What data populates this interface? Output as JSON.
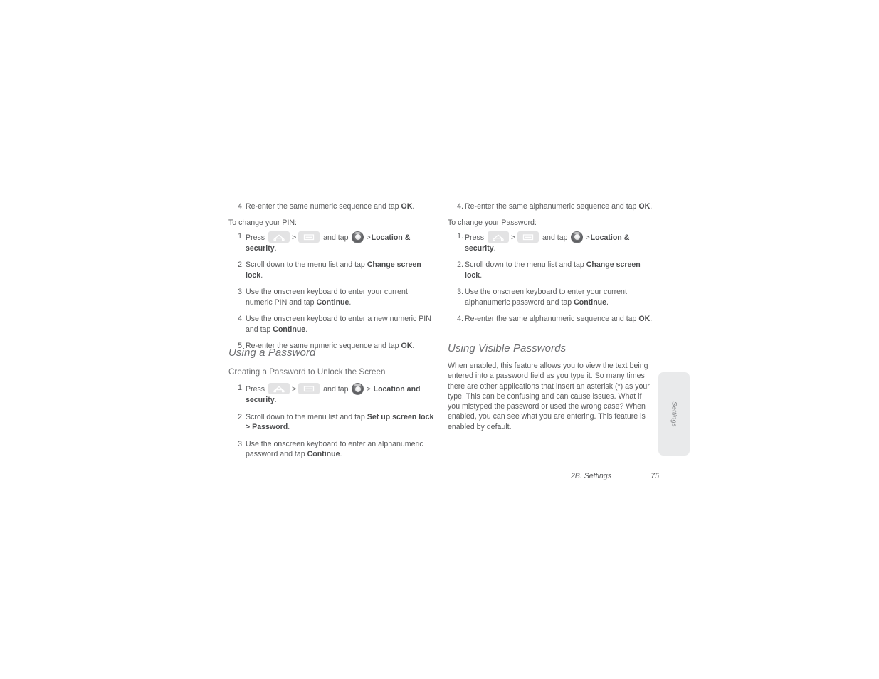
{
  "page": {
    "background": "#ffffff",
    "text_color": "#58595b",
    "heading_color": "#6d6e71"
  },
  "icons": {
    "home": "home-key-icon",
    "menu": "menu-key-icon",
    "trackball": "trackball-icon",
    "separator": ">"
  },
  "left_column": {
    "top_step": {
      "num": "4.",
      "text_before": "Re-enter the same numeric sequence and tap ",
      "bold": "OK",
      "text_after": "."
    },
    "intro": "To change your PIN:",
    "steps": [
      {
        "num": "1.",
        "parts": [
          {
            "type": "text",
            "value": "Press "
          },
          {
            "type": "icon",
            "value": "home-key-icon"
          },
          {
            "type": "text",
            "value": " > "
          },
          {
            "type": "icon",
            "value": "menu-key-icon"
          },
          {
            "type": "text",
            "value": " and tap "
          },
          {
            "type": "icon",
            "value": "trackball-icon"
          },
          {
            "type": "text",
            "value": " > "
          },
          {
            "type": "bold",
            "value": "Location & security"
          },
          {
            "type": "text",
            "value": "."
          }
        ]
      },
      {
        "num": "2.",
        "parts": [
          {
            "type": "text",
            "value": "Scroll down to the menu list and tap "
          },
          {
            "type": "bold",
            "value": "Change screen lock"
          },
          {
            "type": "text",
            "value": "."
          }
        ]
      },
      {
        "num": "3.",
        "parts": [
          {
            "type": "text",
            "value": "Use the onscreen keyboard to enter your current numeric PIN and tap "
          },
          {
            "type": "bold",
            "value": "Continue"
          },
          {
            "type": "text",
            "value": "."
          }
        ]
      },
      {
        "num": "4.",
        "parts": [
          {
            "type": "text",
            "value": "Use the onscreen keyboard to enter a new numeric PIN and tap "
          },
          {
            "type": "bold",
            "value": "Continue"
          },
          {
            "type": "text",
            "value": "."
          }
        ]
      },
      {
        "num": "5.",
        "parts": [
          {
            "type": "text",
            "value": "Re-enter the same numeric sequence and tap "
          },
          {
            "type": "bold",
            "value": "OK"
          },
          {
            "type": "text",
            "value": "."
          }
        ]
      }
    ],
    "section_heading": "Using a Password",
    "sub_heading": "Creating a Password to Unlock the Screen",
    "password_steps": [
      {
        "num": "1.",
        "parts": [
          {
            "type": "text",
            "value": "Press "
          },
          {
            "type": "icon",
            "value": "home-key-icon"
          },
          {
            "type": "text",
            "value": " > "
          },
          {
            "type": "icon",
            "value": "menu-key-icon"
          },
          {
            "type": "text",
            "value": " and tap "
          },
          {
            "type": "icon",
            "value": "trackball-icon"
          },
          {
            "type": "text",
            "value": " > "
          },
          {
            "type": "bold",
            "value": "Location and security"
          },
          {
            "type": "text",
            "value": "."
          }
        ]
      },
      {
        "num": "2.",
        "parts": [
          {
            "type": "text",
            "value": "Scroll down to the menu list and tap "
          },
          {
            "type": "bold",
            "value": "Set up screen lock"
          },
          {
            "type": "bold",
            "value": " > "
          },
          {
            "type": "bold",
            "value": "Password"
          },
          {
            "type": "text",
            "value": "."
          }
        ]
      },
      {
        "num": "3.",
        "parts": [
          {
            "type": "text",
            "value": "Use the onscreen keyboard to enter an alphanumeric password and tap "
          },
          {
            "type": "bold",
            "value": "Continue"
          },
          {
            "type": "text",
            "value": "."
          }
        ]
      }
    ]
  },
  "right_column": {
    "top_step": {
      "num": "4.",
      "text_before": "Re-enter the same alphanumeric sequence and tap ",
      "bold": "OK",
      "text_after": "."
    },
    "intro": "To change your Password:",
    "steps": [
      {
        "num": "1.",
        "parts": [
          {
            "type": "text",
            "value": "Press "
          },
          {
            "type": "icon",
            "value": "home-key-icon"
          },
          {
            "type": "text",
            "value": " > "
          },
          {
            "type": "icon",
            "value": "menu-key-icon"
          },
          {
            "type": "text",
            "value": " and tap "
          },
          {
            "type": "icon",
            "value": "trackball-icon"
          },
          {
            "type": "text",
            "value": " > "
          },
          {
            "type": "bold",
            "value": "Location & security"
          },
          {
            "type": "text",
            "value": "."
          }
        ]
      },
      {
        "num": "2.",
        "parts": [
          {
            "type": "text",
            "value": "Scroll down to the menu list and tap "
          },
          {
            "type": "bold",
            "value": "Change screen lock"
          },
          {
            "type": "text",
            "value": "."
          }
        ]
      },
      {
        "num": "3.",
        "parts": [
          {
            "type": "text",
            "value": "Use the onscreen keyboard to enter your current alphanumeric password and tap "
          },
          {
            "type": "bold",
            "value": "Continue"
          },
          {
            "type": "text",
            "value": "."
          }
        ]
      },
      {
        "num": "4.",
        "parts": [
          {
            "type": "text",
            "value": "Re-enter the same alphanumeric sequence and tap "
          },
          {
            "type": "bold",
            "value": "OK"
          },
          {
            "type": "text",
            "value": "."
          }
        ]
      }
    ],
    "section_heading": "Using Visible Passwords",
    "paragraph": "When enabled, this feature allows you to view the text being entered into a password field as you type it. So many times there are other applications that insert an asterisk (*) as your type. This can be confusing and can cause issues. What if you mistyped the password or used the wrong case? When enabled, you can see what you are entering. This feature is enabled by default."
  },
  "side_tab": {
    "label": "Settings"
  },
  "footer": {
    "chapter": "2B. Settings",
    "page_number": "75"
  }
}
